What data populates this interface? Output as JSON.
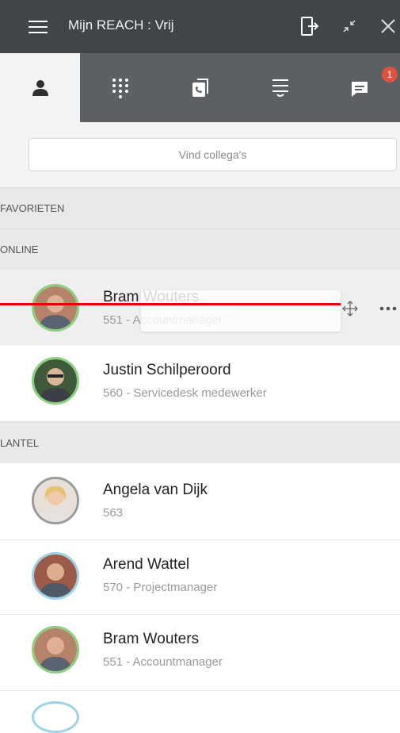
{
  "app": {
    "title": "Mijn REACH : Vrij"
  },
  "tabs": [
    {
      "icon": "person-icon",
      "active": true
    },
    {
      "icon": "dialpad-icon",
      "active": false
    },
    {
      "icon": "phone-card-icon",
      "active": false
    },
    {
      "icon": "call-history-icon",
      "active": false
    },
    {
      "icon": "chat-icon",
      "active": false,
      "badge": "1"
    }
  ],
  "search": {
    "placeholder": "Vind collega's"
  },
  "sections": {
    "favorites": "FAVORIETEN",
    "online": "ONLINE",
    "lantel": "LANTEL"
  },
  "online_contacts": [
    {
      "name": "Bram Wouters",
      "detail": "551 - Accountmanager",
      "status_color": "#8ccf7e"
    },
    {
      "name": "Justin Schilperoord",
      "detail": "560 - Servicedesk medewerker",
      "status_color": "#8ccf7e"
    }
  ],
  "lantel_contacts": [
    {
      "name": "Angela van Dijk",
      "detail": "563",
      "status_color": "#9a9a9a"
    },
    {
      "name": "Arend Wattel",
      "detail": "570 - Projectmanager",
      "status_color": "#9dd2e8"
    },
    {
      "name": "Bram Wouters",
      "detail": "551 - Accountmanager",
      "status_color": "#8ccf7e"
    }
  ],
  "colors": {
    "titlebar": "#424548",
    "tabbar": "#5d6063",
    "online_ring": "#8ccf7e",
    "badge": "#e0523f",
    "drag_line": "#e00000"
  }
}
